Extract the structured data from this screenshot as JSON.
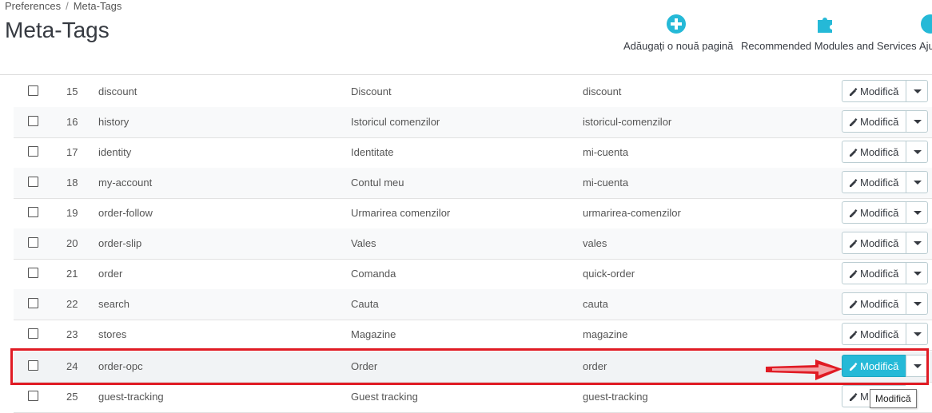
{
  "breadcrumb": {
    "parent": "Preferences",
    "separator": "/",
    "current": "Meta-Tags"
  },
  "page_title": "Meta-Tags",
  "toolbar": {
    "add_page_label": "Adăugați o nouă pagină",
    "recommended_label": "Recommended Modules and Services",
    "help_label": "Aju"
  },
  "colors": {
    "accent": "#25b9d7",
    "highlight": "#e01b24"
  },
  "table": {
    "edit_label": "Modifică",
    "rows": [
      {
        "id": "15",
        "page": "discount",
        "title": "Discount",
        "url": "discount"
      },
      {
        "id": "16",
        "page": "history",
        "title": "Istoricul comenzilor",
        "url": "istoricul-comenzilor"
      },
      {
        "id": "17",
        "page": "identity",
        "title": "Identitate",
        "url": "mi-cuenta"
      },
      {
        "id": "18",
        "page": "my-account",
        "title": "Contul meu",
        "url": "mi-cuenta"
      },
      {
        "id": "19",
        "page": "order-follow",
        "title": "Urmarirea comenzilor",
        "url": "urmarirea-comenzilor"
      },
      {
        "id": "20",
        "page": "order-slip",
        "title": "Vales",
        "url": "vales"
      },
      {
        "id": "21",
        "page": "order",
        "title": "Comanda",
        "url": "quick-order"
      },
      {
        "id": "22",
        "page": "search",
        "title": "Cauta",
        "url": "cauta"
      },
      {
        "id": "23",
        "page": "stores",
        "title": "Magazine",
        "url": "magazine"
      },
      {
        "id": "24",
        "page": "order-opc",
        "title": "Order",
        "url": "order"
      },
      {
        "id": "25",
        "page": "guest-tracking",
        "title": "Guest tracking",
        "url": "guest-tracking"
      }
    ],
    "last_row_edit_label": "M"
  },
  "tooltip": "Modifică"
}
